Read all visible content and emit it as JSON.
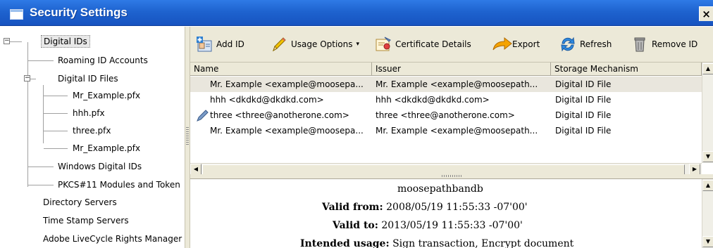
{
  "window": {
    "title": "Security Settings",
    "close_label": "×"
  },
  "tree": {
    "items": [
      {
        "label": "Digital IDs"
      },
      {
        "label": "Roaming ID Accounts"
      },
      {
        "label": "Digital ID Files"
      },
      {
        "label": "Mr_Example.pfx"
      },
      {
        "label": "hhh.pfx"
      },
      {
        "label": "three.pfx"
      },
      {
        "label": "Mr_Example.pfx"
      },
      {
        "label": "Windows Digital IDs"
      },
      {
        "label": "PKCS#11 Modules and Token"
      },
      {
        "label": "Directory Servers"
      },
      {
        "label": "Time Stamp Servers"
      },
      {
        "label": "Adobe LiveCycle Rights Manager"
      }
    ],
    "expander_minus": "−"
  },
  "toolbar": {
    "add_id": "Add ID",
    "usage_options": "Usage Options",
    "usage_caret": "▾",
    "certificate_details": "Certificate Details",
    "export": "Export",
    "refresh": "Refresh",
    "remove_id": "Remove ID"
  },
  "grid": {
    "columns": [
      "Name",
      "Issuer",
      "Storage Mechanism"
    ],
    "rows": [
      {
        "name": "Mr. Example <example@moosepa...",
        "issuer": "Mr. Example <example@moosepath...",
        "storage": "Digital ID File"
      },
      {
        "name": "hhh <dkdkd@dkdkd.com>",
        "issuer": "hhh <dkdkd@dkdkd.com>",
        "storage": "Digital ID File"
      },
      {
        "name": "three <three@anotherone.com>",
        "issuer": "three <three@anotherone.com>",
        "storage": "Digital ID File"
      },
      {
        "name": "Mr. Example <example@moosepa...",
        "issuer": "Mr. Example <example@moosepath...",
        "storage": "Digital ID File"
      }
    ]
  },
  "details": {
    "org": "moosepathbandb",
    "valid_from_label": "Valid from:",
    "valid_from": "2008/05/19 11:55:33 -07'00'",
    "valid_to_label": "Valid to:",
    "valid_to": "2013/05/19 11:55:33 -07'00'",
    "usage_label": "Intended usage:",
    "usage": "Sign transaction, Encrypt document"
  },
  "scroll": {
    "up": "▲",
    "down": "▼",
    "left": "◀",
    "right": "▶"
  },
  "colors": {
    "title_bar": "#1e63cf",
    "window_bg": "#ece9d8"
  }
}
